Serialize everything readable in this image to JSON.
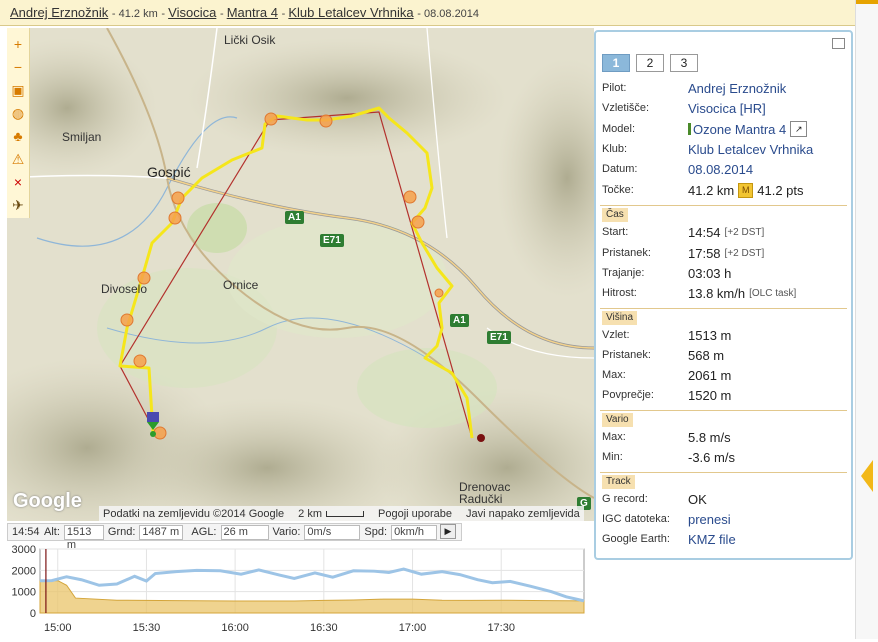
{
  "header": {
    "pilot": "Andrej Erznožnik",
    "distance": "41.2 km",
    "launch": "Visocica",
    "glider": "Mantra 4",
    "club": "Klub Letalcev Vrhnika",
    "date": "08.08.2014",
    "sep": "-"
  },
  "map": {
    "places": {
      "licki_osik": "Lički Osik",
      "smiljan": "Smiljan",
      "gospic": "Gospić",
      "ornice": "Ornice",
      "divoselo": "Divoselo",
      "drenovac": "Drenovac",
      "raducki": "Radučki"
    },
    "roads": {
      "a1": "A1",
      "e71": "E71",
      "g": "G"
    },
    "google": "Google",
    "attribution": {
      "data": "Podatki na zemljevidu ©2014 Google",
      "scale": "2 km",
      "terms": "Pogoji uporabe",
      "report": "Javi napako zemljevida"
    },
    "toolbar": [
      "+",
      "−",
      "▣",
      "◍",
      "♣",
      "⚠",
      "×",
      "✈"
    ]
  },
  "status": {
    "time": "14:54",
    "alt_label": "Alt:",
    "alt": "1513 m",
    "grnd_label": "Grnd:",
    "grnd": "1487 m",
    "agl_label": "AGL:",
    "agl": "26 m",
    "vario_label": "Vario:",
    "vario": "0m/s",
    "spd_label": "Spd:",
    "spd": "0km/h"
  },
  "chart_data": {
    "type": "area",
    "y_ticks": [
      "3000",
      "2000",
      "1000",
      "0"
    ],
    "x_ticks": [
      "15:00",
      "15:30",
      "16:00",
      "16:30",
      "17:00",
      "17:30"
    ],
    "ylim": [
      0,
      3000
    ],
    "xlim": [
      "14:54",
      "17:58"
    ],
    "series": [],
    "altitude": [
      [
        "14:54",
        1513
      ],
      [
        "14:58",
        1520
      ],
      [
        "15:03",
        1700
      ],
      [
        "15:08",
        1560
      ],
      [
        "15:14",
        1300
      ],
      [
        "15:20",
        1360
      ],
      [
        "15:26",
        1720
      ],
      [
        "15:30",
        1500
      ],
      [
        "15:33",
        1850
      ],
      [
        "15:40",
        1940
      ],
      [
        "15:47",
        2000
      ],
      [
        "15:55",
        1980
      ],
      [
        "16:02",
        1820
      ],
      [
        "16:08",
        2020
      ],
      [
        "16:15",
        1780
      ],
      [
        "16:20",
        1620
      ],
      [
        "16:27",
        1880
      ],
      [
        "16:33",
        1680
      ],
      [
        "16:40",
        1980
      ],
      [
        "16:47",
        1960
      ],
      [
        "16:52",
        1900
      ],
      [
        "16:57",
        2061
      ],
      [
        "17:03",
        1820
      ],
      [
        "17:10",
        1940
      ],
      [
        "17:16",
        1800
      ],
      [
        "17:22",
        1560
      ],
      [
        "17:27",
        1420
      ],
      [
        "17:33",
        1480
      ],
      [
        "17:40",
        1250
      ],
      [
        "17:47",
        1000
      ],
      [
        "17:52",
        760
      ],
      [
        "17:58",
        568
      ]
    ],
    "ground": [
      [
        "14:54",
        1487
      ],
      [
        "15:00",
        1520
      ],
      [
        "15:03",
        1300
      ],
      [
        "15:06",
        700
      ],
      [
        "15:20",
        600
      ],
      [
        "15:40",
        580
      ],
      [
        "16:00",
        560
      ],
      [
        "16:20",
        560
      ],
      [
        "16:30",
        590
      ],
      [
        "16:40",
        610
      ],
      [
        "16:50",
        650
      ],
      [
        "17:00",
        650
      ],
      [
        "17:10",
        600
      ],
      [
        "17:20",
        590
      ],
      [
        "17:30",
        600
      ],
      [
        "17:45",
        580
      ],
      [
        "17:58",
        568
      ]
    ],
    "cursor": "14:56"
  },
  "panel": {
    "tabs": [
      "1",
      "2",
      "3"
    ],
    "pilot_label": "Pilot:",
    "pilot": "Andrej Erznožnik",
    "launch_label": "Vzletišče:",
    "launch": "Visocica [HR]",
    "model_label": "Model:",
    "model": "Ozone Mantra 4",
    "club_label": "Klub:",
    "club": "Klub Letalcev Vrhnika",
    "date_label": "Datum:",
    "date": "08.08.2014",
    "points_label": "Točke:",
    "distance": "41.2 km",
    "points": "41.2 pts",
    "cas": "Čas",
    "start_label": "Start:",
    "start": "14:54",
    "start_dst": "[+2 DST]",
    "land_label": "Pristanek:",
    "land": "17:58",
    "land_dst": "[+2 DST]",
    "dur_label": "Trajanje:",
    "dur": "03:03 h",
    "speed_label": "Hitrost:",
    "speed": "13.8 km/h",
    "speed_note": "[OLC task]",
    "visina": "Višina",
    "takeoff_alt_label": "Vzlet:",
    "takeoff_alt": "1513 m",
    "land_alt_label": "Pristanek:",
    "land_alt": "568 m",
    "max_alt_label": "Max:",
    "max_alt": "2061 m",
    "avg_alt_label": "Povprečje:",
    "avg_alt": "1520 m",
    "vario": "Vario",
    "vmax_label": "Max:",
    "vmax": "5.8 m/s",
    "vmin_label": "Min:",
    "vmin": "-3.6 m/s",
    "track": "Track",
    "grecord_label": "G record:",
    "grecord": "OK",
    "igc_label": "IGC datoteka:",
    "igc": "prenesi",
    "ge_label": "Google Earth:",
    "ge": "KMZ file"
  },
  "colors": {
    "track": "#f5e61b",
    "task": "#b3312d",
    "turnpoint": "#f6a04a",
    "altitude": "#9dc4e6",
    "ground": "#e9c46a"
  }
}
